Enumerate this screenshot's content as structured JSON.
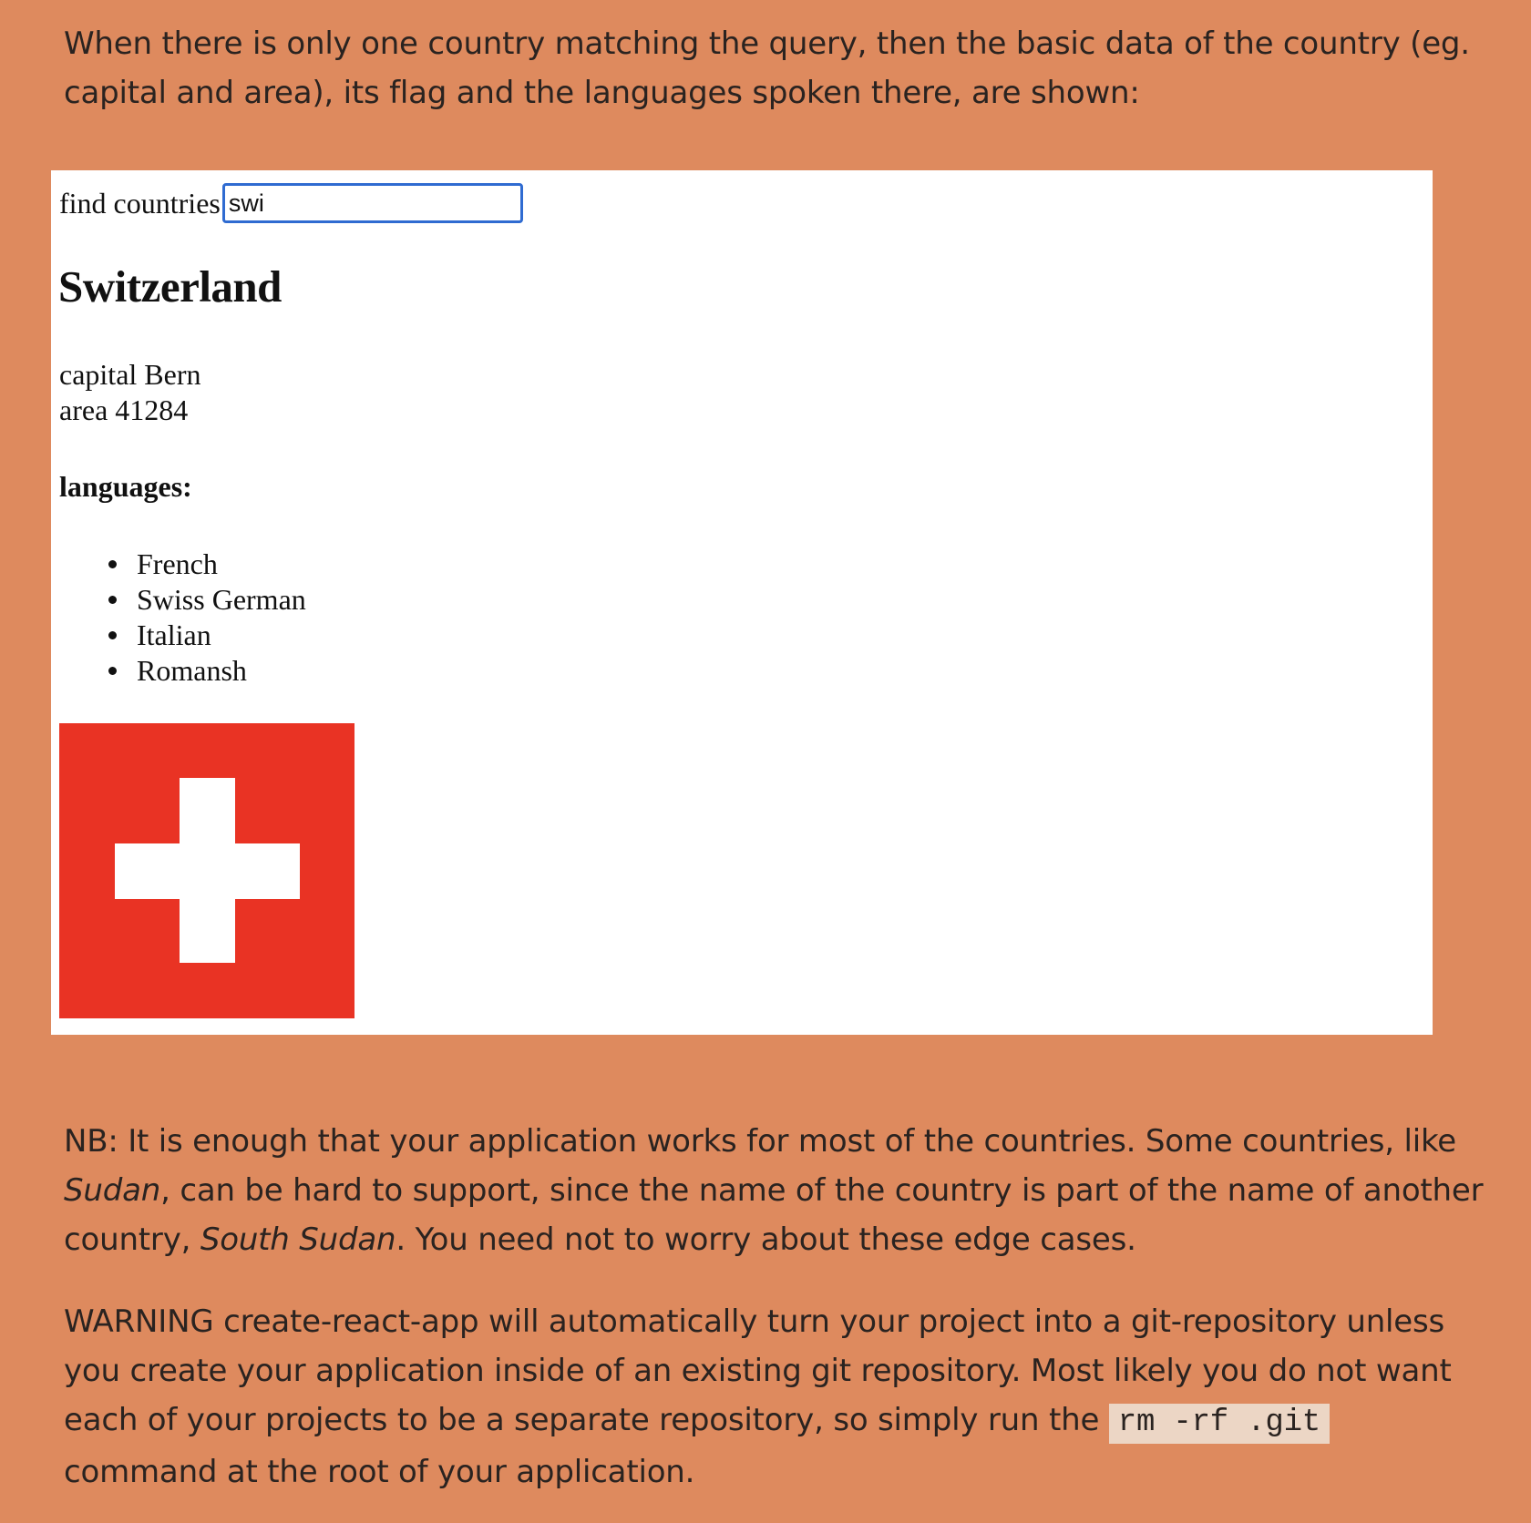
{
  "intro_text": "When there is only one country matching the query, then the basic data of the country (eg. capital and area), its flag and the languages spoken there, are shown:",
  "app": {
    "find_label": "find countries",
    "search_value": "swi",
    "country_name": "Switzerland",
    "capital_label": "capital",
    "capital": "Bern",
    "area_label": "area",
    "area": "41284",
    "languages_heading": "languages:",
    "languages": [
      "French",
      "Swiss German",
      "Italian",
      "Romansh"
    ],
    "flag": {
      "icon": "swiss-flag",
      "background": "#e93324",
      "cross": "#ffffff"
    }
  },
  "nb": {
    "part1": "NB: It is enough that your application works for most of the countries. Some countries, like ",
    "em1": "Sudan",
    "part2": ", can be hard to support, since the name of the country is part of the name of another country, ",
    "em2": "South Sudan",
    "part3": ". You need not to worry about these edge cases."
  },
  "warning": {
    "part1": "WARNING create-react-app will automatically turn your project into a git-repository unless you create your application inside of an existing git repository. Most likely you do not want each of your projects to be a separate repository, so simply run the ",
    "code": "rm -rf .git",
    "part2": " command at the root of your application."
  },
  "colors": {
    "page_background": "#de8a5e",
    "input_focus_border": "#2f6bd1",
    "code_background": "#ecd6c5"
  }
}
